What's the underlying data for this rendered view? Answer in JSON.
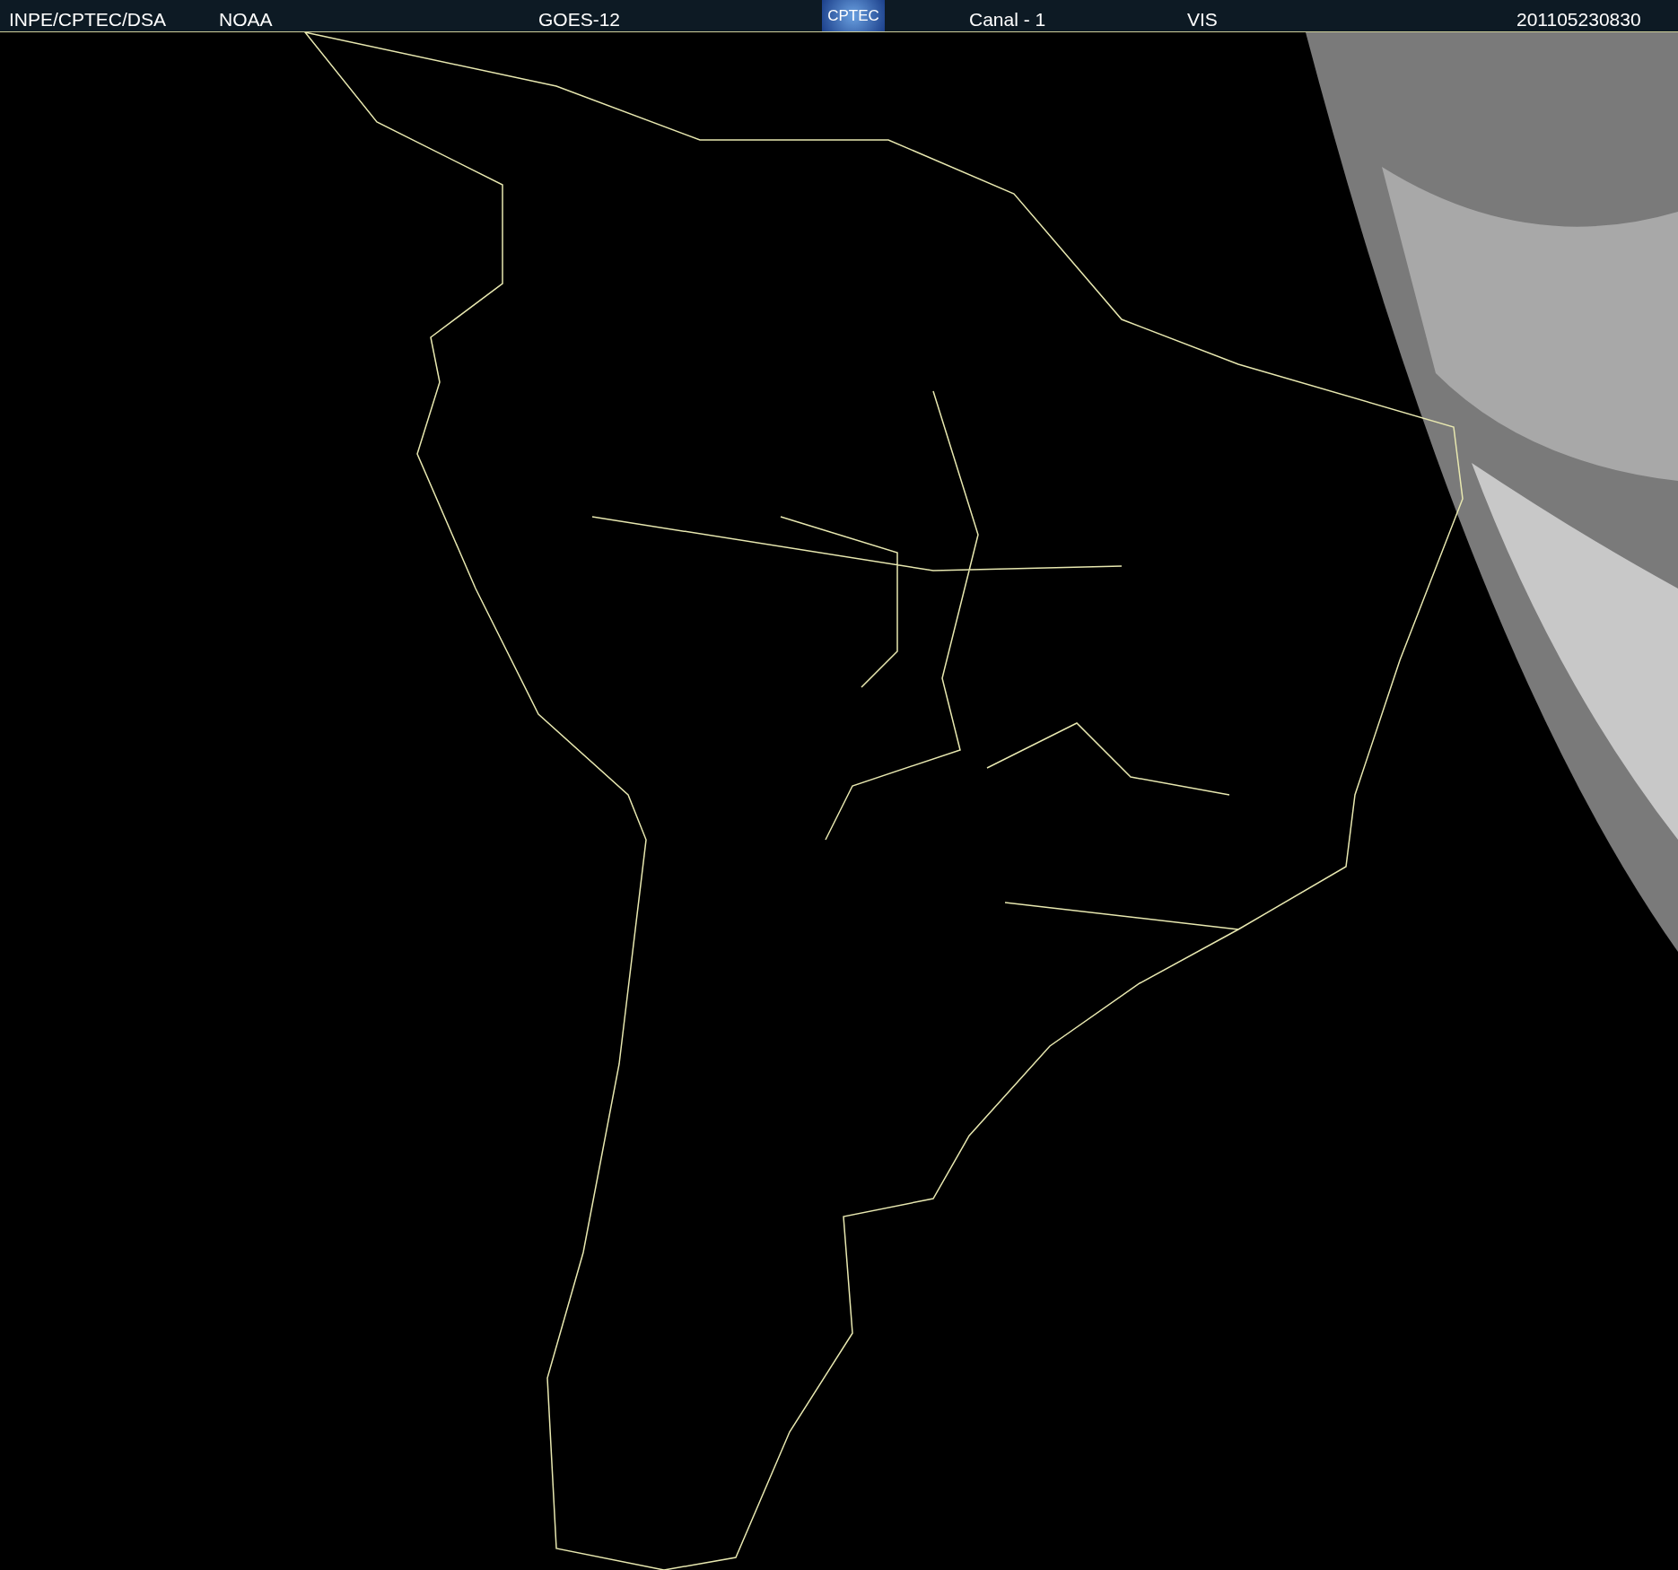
{
  "header": {
    "agency": "INPE/CPTEC/DSA",
    "source": "NOAA",
    "satellite": "GOES-12",
    "logo": "CPTEC",
    "channel": "Canal - 1",
    "band": "VIS",
    "timestamp": "201105230830"
  }
}
